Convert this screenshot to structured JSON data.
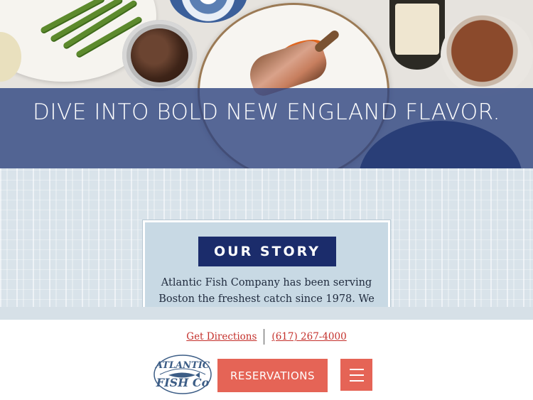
{
  "hero": {
    "headline": "DIVE INTO BOLD NEW ENGLAND FLAVOR."
  },
  "story": {
    "title": "OUR STORY",
    "text_line1": "Atlantic Fish Company has been serving",
    "text_line2": "Boston the freshest catch since 1978. We"
  },
  "footer": {
    "directions_label": "Get Directions",
    "phone_label": "(617) 267-4000",
    "reservations_label": "RESERVATIONS",
    "logo_text_top": "ATLANTIC",
    "logo_text_bottom": "FISH Co",
    "menu_icon": "hamburger-icon"
  },
  "colors": {
    "hero_band": "#2d4480",
    "story_title_bg": "#1b2c6b",
    "accent_red": "#e56456",
    "link_red": "#c4302b",
    "logo_blue": "#3c5d86"
  }
}
